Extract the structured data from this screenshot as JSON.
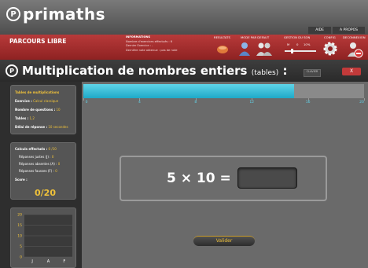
{
  "app": {
    "logo_mark": "P",
    "logo_text": "primaths",
    "nav": [
      "AIDE",
      "A PROPOS"
    ]
  },
  "header": {
    "mode": "PARCOURS LIBRE",
    "info_title": "INFORMATIONS",
    "info_lines": [
      "Nombre d'exercices effectués : 6",
      "Dernier Exercice : -",
      "Dernière note obtenue : pas de note"
    ],
    "labels": {
      "resultats": "RESULTATS",
      "mode_defaut": "MODE PAR DEFAUT",
      "gestion_son": "GESTION DU SON",
      "config": "CONFIG",
      "deconnexion": "DECONNEXION"
    },
    "sound_min": "M",
    "sound_value": "0",
    "sound_max": "10%"
  },
  "exercise": {
    "title": "Multiplication de nombres entiers",
    "subtitle": "(tables)",
    "suffix": ":",
    "keyboard_label": "CLAVIER",
    "close_label": "X"
  },
  "settings_panel": {
    "title": "Tables de multiplications",
    "exercise_label": "Exercice :",
    "exercise_value": "Calcul classique",
    "questions_label": "Nombre de questions :",
    "questions_value": "10",
    "tables_label": "Tables :",
    "tables_value": "1,2",
    "delay_label": "Délai de réponse :",
    "delay_value": "10 secondes"
  },
  "stats_panel": {
    "done_label": "Calculs effectués :",
    "done_value": "0 /10",
    "correct_label": "Réponses justes (J) :",
    "correct_value": "0",
    "missing_label": "Réponses absentes (A) :",
    "missing_value": "0",
    "wrong_label": "Réponses fausses (F) :",
    "wrong_value": "0",
    "score_label": "Score :",
    "score_value": "0/20"
  },
  "chart_data": {
    "type": "bar",
    "categories": [
      "J",
      "A",
      "F"
    ],
    "values": [
      0,
      0,
      0
    ],
    "yticks": [
      "20",
      "15",
      "10",
      "5",
      "0"
    ],
    "ylim": [
      0,
      20
    ]
  },
  "progress": {
    "value_fraction": 0.75,
    "ticks": [
      "0",
      "4",
      "8",
      "12",
      "16",
      "20"
    ]
  },
  "question": {
    "text": "5 × 10 =",
    "answer": ""
  },
  "validate_label": "Valider",
  "colors": {
    "accent": "#f0c23a",
    "header_red": "#a82f2f",
    "progress": "#3cc4e0"
  }
}
